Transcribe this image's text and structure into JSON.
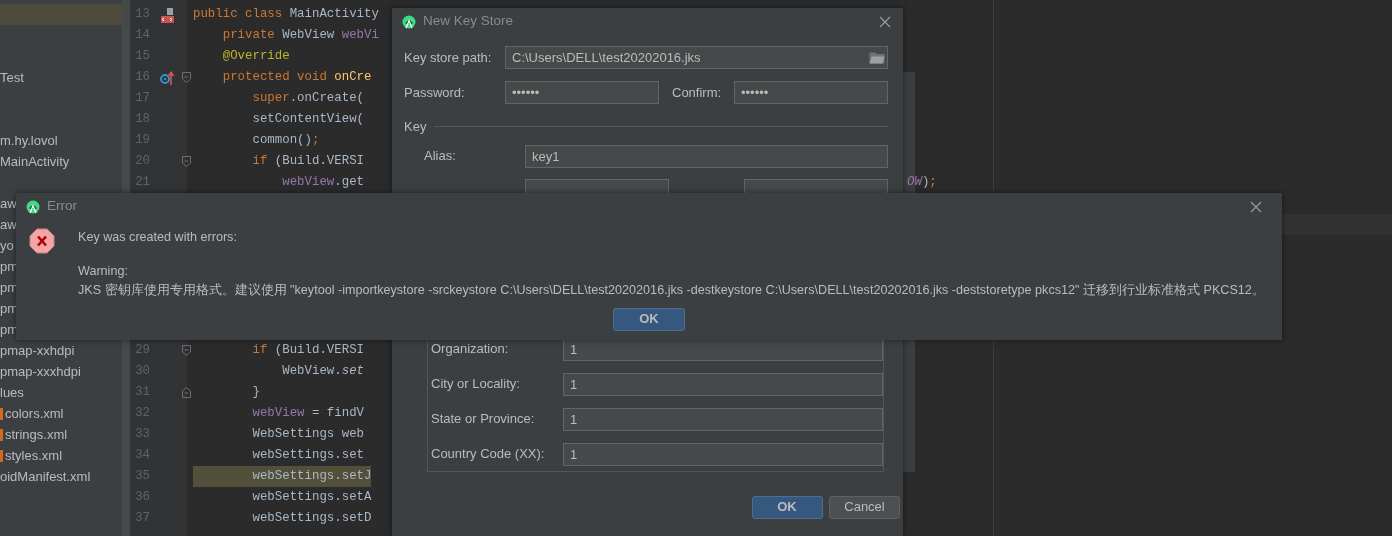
{
  "project_tree": {
    "groups": [
      [
        {
          "selected": true
        }
      ],
      [
        {
          "label": "Test",
          "selected": false
        }
      ],
      [
        {
          "label": "m.hy.lovol",
          "selected": false
        },
        {
          "label": "MainActivity",
          "selected": false
        }
      ],
      [
        {
          "label": "aw",
          "selected": false
        },
        {
          "label": "aw",
          "selected": false
        },
        {
          "label": "yo",
          "selected": false
        },
        {
          "label": "pm",
          "selected": false
        },
        {
          "label": "pm",
          "selected": false
        },
        {
          "label": "pm",
          "selected": false
        },
        {
          "label": "pm",
          "selected": false
        },
        {
          "label": "pmap-xxhdpi",
          "selected": false
        },
        {
          "label": "pmap-xxxhdpi",
          "selected": false
        },
        {
          "label": "lues",
          "selected": false
        },
        {
          "label": "colors.xml",
          "kind": "xml",
          "selected": false
        },
        {
          "label": "strings.xml",
          "kind": "xml",
          "selected": false
        },
        {
          "label": "styles.xml",
          "kind": "xml",
          "selected": false
        },
        {
          "label": "oidManifest.xml",
          "selected": false
        }
      ]
    ]
  },
  "editor": {
    "blocks": [
      [
        {
          "number": "13",
          "class_marker": true,
          "tokens": [
            {
              "text": "public class ",
              "kind": "keyword"
            },
            {
              "text": "MainActivity",
              "kind": "plain"
            }
          ]
        },
        {
          "number": "14",
          "tokens": [
            {
              "text": "    private ",
              "kind": "keyword"
            },
            {
              "text": "WebView ",
              "kind": "plain"
            },
            {
              "text": "webVi",
              "kind": "field"
            }
          ]
        },
        {
          "number": "15",
          "tokens": [
            {
              "text": "    @Override",
              "kind": "annotation"
            }
          ]
        },
        {
          "number": "16",
          "override_marker": true,
          "fold_start": true,
          "tokens": [
            {
              "text": "    protected void ",
              "kind": "keyword"
            },
            {
              "text": "onCre",
              "kind": "method"
            }
          ]
        },
        {
          "number": "17",
          "tokens": [
            {
              "text": "        super",
              "kind": "keyword"
            },
            {
              "text": ".onCreate(",
              "kind": "plain"
            }
          ]
        },
        {
          "number": "18",
          "tokens": [
            {
              "text": "        setContentView(",
              "kind": "plain"
            }
          ]
        },
        {
          "number": "19",
          "tokens": [
            {
              "text": "        common()",
              "kind": "plain"
            },
            {
              "text": ";",
              "kind": "keyword"
            }
          ]
        },
        {
          "number": "20",
          "fold_start": true,
          "tokens": [
            {
              "text": "        if ",
              "kind": "keyword"
            },
            {
              "text": "(Build.VERSI",
              "kind": "plain"
            }
          ]
        },
        {
          "number": "21",
          "tokens": [
            {
              "text": "            webView",
              "kind": "field"
            },
            {
              "text": ".get",
              "kind": "plain"
            }
          ],
          "tail": [
            {
              "text": "OW",
              "kind": "constant"
            },
            {
              "text": ")",
              "kind": "plain"
            },
            {
              "text": ";",
              "kind": "keyword"
            }
          ]
        }
      ],
      [
        {
          "number": "29",
          "fold_start": true,
          "tokens": [
            {
              "text": "        if ",
              "kind": "keyword"
            },
            {
              "text": "(Build.VERSI",
              "kind": "plain"
            }
          ]
        },
        {
          "number": "30",
          "tokens": [
            {
              "text": "            WebView.",
              "kind": "plain"
            },
            {
              "text": "set",
              "kind": "static"
            }
          ]
        },
        {
          "number": "31",
          "fold_end": true,
          "tokens": [
            {
              "text": "        }",
              "kind": "plain"
            }
          ]
        },
        {
          "number": "32",
          "tokens": [
            {
              "text": "        webView",
              "kind": "field"
            },
            {
              "text": " = findV",
              "kind": "plain"
            }
          ]
        },
        {
          "number": "33",
          "tokens": [
            {
              "text": "        WebSettings web",
              "kind": "plain"
            }
          ]
        },
        {
          "number": "34",
          "tokens": [
            {
              "text": "        webSettings.set",
              "kind": "plain"
            }
          ]
        },
        {
          "number": "35",
          "highlighted": true,
          "tokens": [
            {
              "text": "        webSettings.setJ",
              "kind": "plain"
            }
          ]
        },
        {
          "number": "36",
          "tokens": [
            {
              "text": "        webSettings.setA",
              "kind": "plain"
            }
          ]
        },
        {
          "number": "37",
          "tokens": [
            {
              "text": "        webSettings.setD",
              "kind": "plain"
            }
          ]
        }
      ]
    ]
  },
  "key_store_dialog": {
    "title": "New Key Store",
    "path": {
      "label": "Key store path:",
      "value": "C:\\Users\\DELL\\test20202016.jks"
    },
    "password": {
      "label": "Password:",
      "value": "••••••"
    },
    "confirm": {
      "label": "Confirm:",
      "value": "••••••"
    },
    "key_section": {
      "title": "Key",
      "alias": {
        "label": "Alias:",
        "value": "key1"
      },
      "certificate": [
        {
          "label": "Organization:",
          "value": "1"
        },
        {
          "label": "City or Locality:",
          "value": "1"
        },
        {
          "label": "State or Province:",
          "value": "1"
        },
        {
          "label": "Country Code (XX):",
          "value": "1"
        }
      ]
    },
    "buttons": [
      {
        "label": "OK",
        "default": true
      },
      {
        "label": "Cancel",
        "default": false
      }
    ]
  },
  "error_dialog": {
    "title": "Error",
    "heading": "Key was created with errors:",
    "warning_label": "Warning:",
    "message": "JKS 密钥库使用专用格式。建议使用 \"keytool -importkeystore -srckeystore C:\\Users\\DELL\\test20202016.jks -destkeystore C:\\Users\\DELL\\test20202016.jks -deststoretype pkcs12\" 迁移到行业标准格式 PKCS12。",
    "button": "OK"
  }
}
